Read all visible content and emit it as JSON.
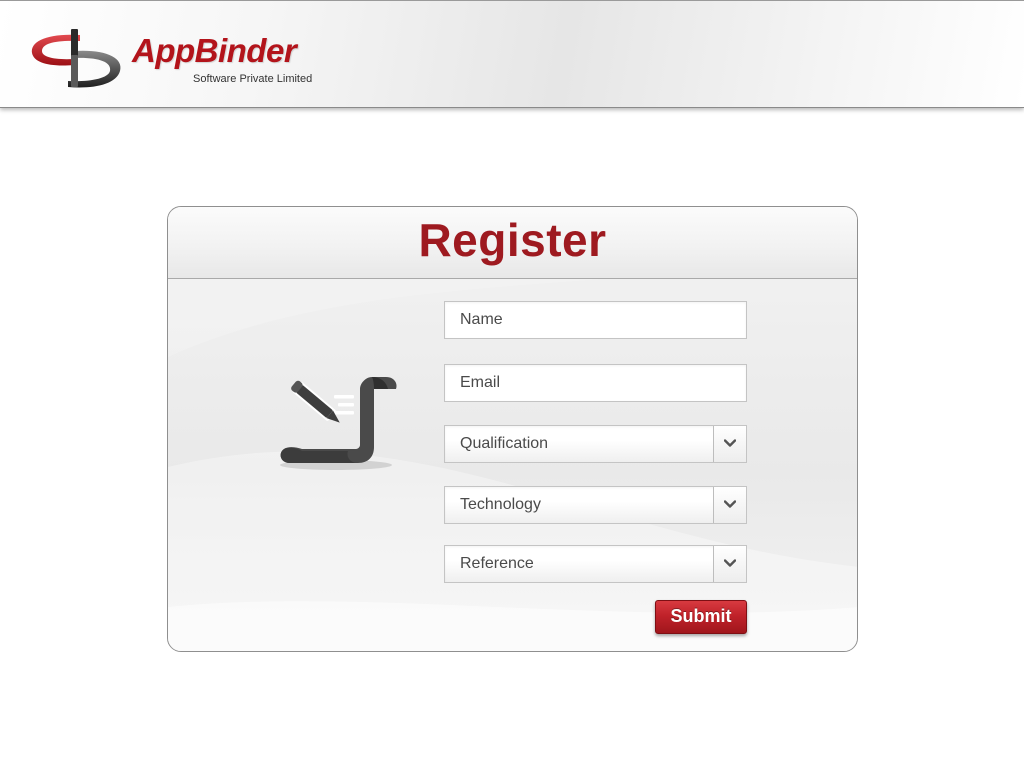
{
  "header": {
    "brand_name": "AppBinder",
    "brand_tagline": "Software Private Limited"
  },
  "register": {
    "title": "Register",
    "illustration_icon": "form-edit-icon",
    "fields": {
      "name": {
        "placeholder": "Name"
      },
      "email": {
        "placeholder": "Email"
      },
      "qualification": {
        "selected": "Qualification"
      },
      "technology": {
        "selected": "Technology"
      },
      "reference": {
        "selected": "Reference"
      }
    },
    "submit_label": "Submit"
  },
  "colors": {
    "brand_red": "#b3141b",
    "title_red": "#9e1a20",
    "button_red": "#c0222a",
    "icon_gray": "#4a4a4a"
  }
}
